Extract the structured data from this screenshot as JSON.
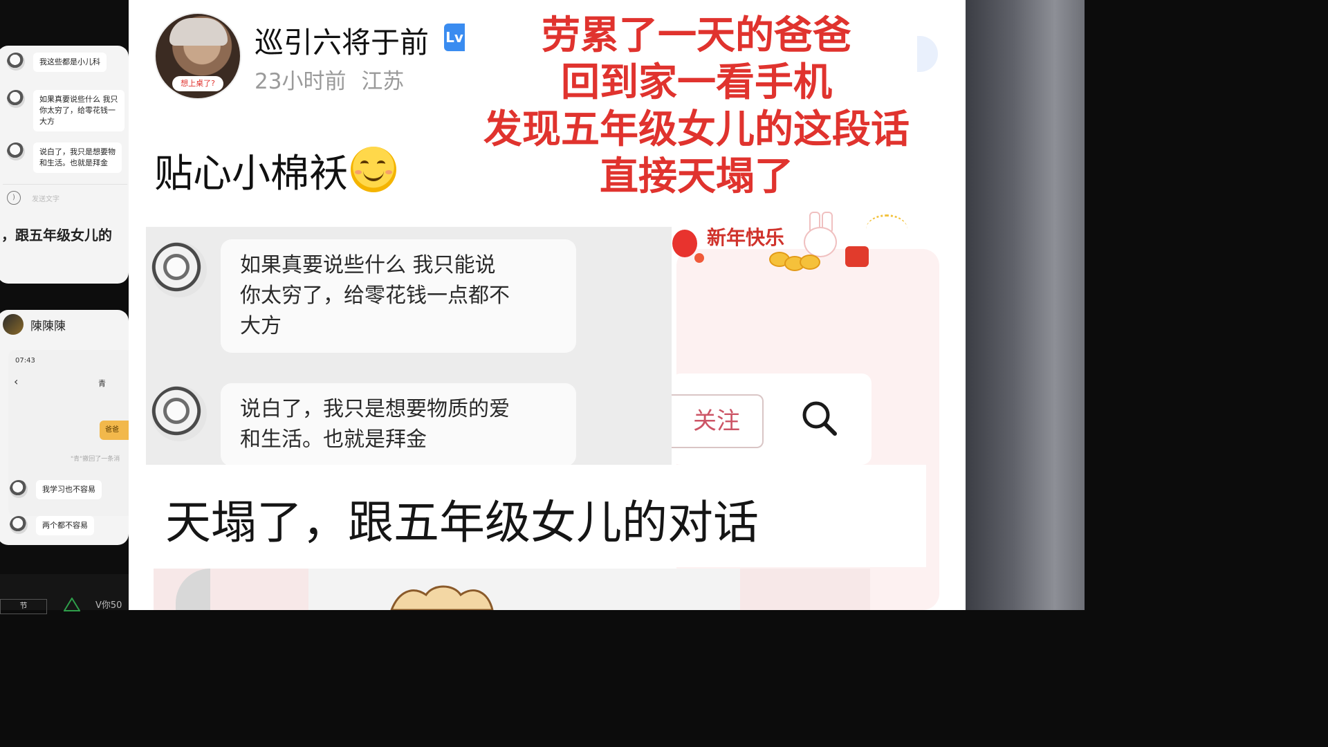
{
  "left_panel": {
    "card1": {
      "messages": [
        "我这些都是小儿科",
        "如果真要说些什么 我只\n你太穷了，给零花钱一\n大方",
        "说白了，我只是想要物\n和生活。也就是拜金"
      ],
      "input_placeholder": "发送文字",
      "caption": "，跟五年级女儿的"
    },
    "card2": {
      "user_name": "陳陳陳",
      "time": "07:43",
      "title": "青",
      "pill": "爸爸",
      "note": "\"青\"撤回了一条消",
      "messages": [
        "我学习也不容易",
        "两个都不容易"
      ]
    },
    "bottom_bar": {
      "box_label": "节",
      "text": "V你50"
    }
  },
  "post": {
    "username": "巡引六将于前",
    "level_badge": "Lv",
    "avatar_badge": "想上桌了?",
    "time": "23小时前",
    "location": "江苏",
    "text": "贴心小棉袄",
    "overlay_lines": [
      "劳累了一天的爸爸",
      "回到家一看手机",
      "发现五年级女儿的这段话",
      "直接天塌了"
    ],
    "new_year_text": "新年快乐",
    "follow_label": "关注",
    "chat": {
      "messages": [
        "如果真要说些什么 我只能说\n你太穷了，给零花钱一点都不\n大方",
        "说白了，我只是想要物质的爱\n和生活。也就是拜金"
      ]
    },
    "caption": "天塌了，跟五年级女儿的对话"
  },
  "colors": {
    "overlay_red": "#e0332e",
    "level_blue": "#3a8cf0",
    "meta_gray": "#9a9a9a"
  }
}
